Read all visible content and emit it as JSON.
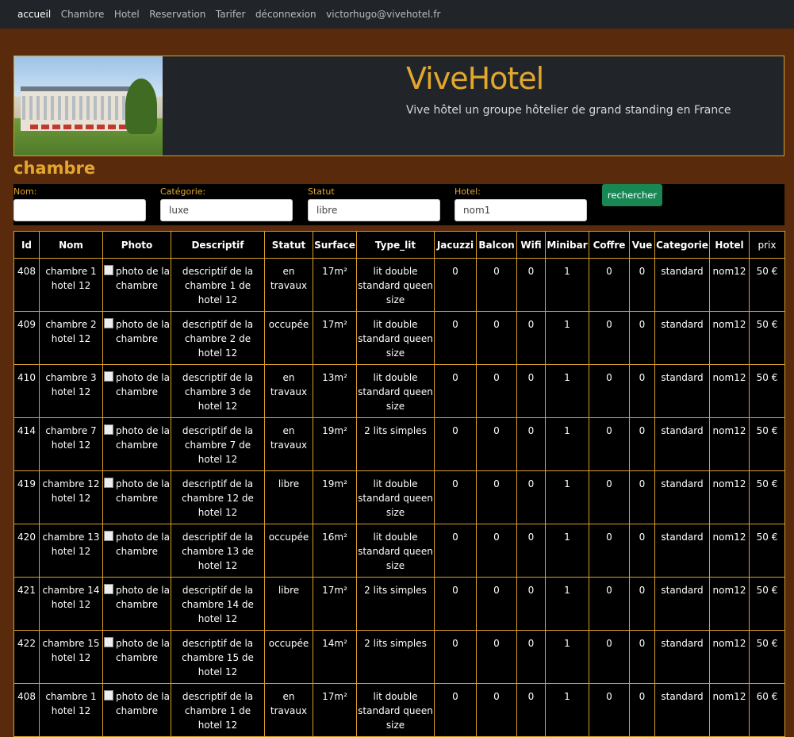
{
  "nav": {
    "items": [
      "accueil",
      "Chambre",
      "Hotel",
      "Reservation",
      "Tarifer",
      "déconnexion",
      "victorhugo@vivehotel.fr"
    ]
  },
  "banner": {
    "title": "ViveHotel",
    "subtitle": "Vive hôtel un groupe hôtelier de grand standing en France"
  },
  "page_title": "chambre",
  "filters": {
    "nom": {
      "label": "Nom:",
      "value": ""
    },
    "categorie": {
      "label": "Catégorie:",
      "value": "luxe"
    },
    "statut": {
      "label": "Statut",
      "value": "libre"
    },
    "hotel": {
      "label": "Hotel:",
      "value": "nom1"
    },
    "search_label": "rechercher"
  },
  "table": {
    "headers": [
      "Id",
      "Nom",
      "Photo",
      "Descriptif",
      "Statut",
      "Surface",
      "Type_lit",
      "Jacuzzi",
      "Balcon",
      "Wifi",
      "Minibar",
      "Coffre",
      "Vue",
      "Categorie",
      "Hotel",
      "prix"
    ],
    "photo_alt": "photo de la chambre",
    "rows": [
      {
        "id": "408",
        "nom": "chambre 1 hotel 12",
        "desc": "descriptif de la chambre 1 de hotel 12",
        "statut": "en travaux",
        "surface": "17m²",
        "type_lit": "lit double standard queen size",
        "jacuzzi": "0",
        "balcon": "0",
        "wifi": "0",
        "minibar": "1",
        "coffre": "0",
        "vue": "0",
        "categorie": "standard",
        "hotel": "nom12",
        "prix": "50 €"
      },
      {
        "id": "409",
        "nom": "chambre 2 hotel 12",
        "desc": "descriptif de la chambre 2 de hotel 12",
        "statut": "occupée",
        "surface": "17m²",
        "type_lit": "lit double standard queen size",
        "jacuzzi": "0",
        "balcon": "0",
        "wifi": "0",
        "minibar": "1",
        "coffre": "0",
        "vue": "0",
        "categorie": "standard",
        "hotel": "nom12",
        "prix": "50 €"
      },
      {
        "id": "410",
        "nom": "chambre 3 hotel 12",
        "desc": "descriptif de la chambre 3 de hotel 12",
        "statut": "en travaux",
        "surface": "13m²",
        "type_lit": "lit double standard queen size",
        "jacuzzi": "0",
        "balcon": "0",
        "wifi": "0",
        "minibar": "1",
        "coffre": "0",
        "vue": "0",
        "categorie": "standard",
        "hotel": "nom12",
        "prix": "50 €"
      },
      {
        "id": "414",
        "nom": "chambre 7 hotel 12",
        "desc": "descriptif de la chambre 7 de hotel 12",
        "statut": "en travaux",
        "surface": "19m²",
        "type_lit": "2 lits simples",
        "jacuzzi": "0",
        "balcon": "0",
        "wifi": "0",
        "minibar": "1",
        "coffre": "0",
        "vue": "0",
        "categorie": "standard",
        "hotel": "nom12",
        "prix": "50 €"
      },
      {
        "id": "419",
        "nom": "chambre 12 hotel 12",
        "desc": "descriptif de la chambre 12 de hotel 12",
        "statut": "libre",
        "surface": "19m²",
        "type_lit": "lit double standard queen size",
        "jacuzzi": "0",
        "balcon": "0",
        "wifi": "0",
        "minibar": "1",
        "coffre": "0",
        "vue": "0",
        "categorie": "standard",
        "hotel": "nom12",
        "prix": "50 €"
      },
      {
        "id": "420",
        "nom": "chambre 13 hotel 12",
        "desc": "descriptif de la chambre 13 de hotel 12",
        "statut": "occupée",
        "surface": "16m²",
        "type_lit": "lit double standard queen size",
        "jacuzzi": "0",
        "balcon": "0",
        "wifi": "0",
        "minibar": "1",
        "coffre": "0",
        "vue": "0",
        "categorie": "standard",
        "hotel": "nom12",
        "prix": "50 €"
      },
      {
        "id": "421",
        "nom": "chambre 14 hotel 12",
        "desc": "descriptif de la chambre 14 de hotel 12",
        "statut": "libre",
        "surface": "17m²",
        "type_lit": "2 lits simples",
        "jacuzzi": "0",
        "balcon": "0",
        "wifi": "0",
        "minibar": "1",
        "coffre": "0",
        "vue": "0",
        "categorie": "standard",
        "hotel": "nom12",
        "prix": "50 €"
      },
      {
        "id": "422",
        "nom": "chambre 15 hotel 12",
        "desc": "descriptif de la chambre 15 de hotel 12",
        "statut": "occupée",
        "surface": "14m²",
        "type_lit": "2 lits simples",
        "jacuzzi": "0",
        "balcon": "0",
        "wifi": "0",
        "minibar": "1",
        "coffre": "0",
        "vue": "0",
        "categorie": "standard",
        "hotel": "nom12",
        "prix": "50 €"
      },
      {
        "id": "408",
        "nom": "chambre 1 hotel 12",
        "desc": "descriptif de la chambre 1 de hotel 12",
        "statut": "en travaux",
        "surface": "17m²",
        "type_lit": "lit double standard queen size",
        "jacuzzi": "0",
        "balcon": "0",
        "wifi": "0",
        "minibar": "1",
        "coffre": "0",
        "vue": "0",
        "categorie": "standard",
        "hotel": "nom12",
        "prix": "60 €"
      }
    ]
  }
}
